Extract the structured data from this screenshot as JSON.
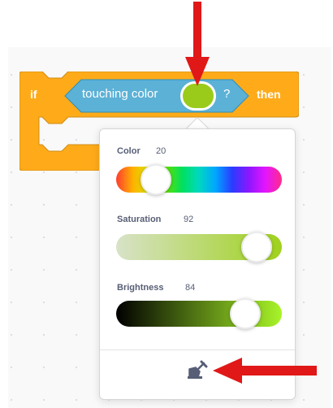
{
  "block": {
    "if_label": "if",
    "sensing_label": "touching color",
    "question_mark": "?",
    "then_label": "then",
    "selected_color": "#9acb1a",
    "control_color": "#ffab19",
    "sensing_color": "#5cb1d6"
  },
  "picker": {
    "color": {
      "label": "Color",
      "value": "20"
    },
    "saturation": {
      "label": "Saturation",
      "value": "92"
    },
    "brightness": {
      "label": "Brightness",
      "value": "84"
    },
    "eyedropper_icon": "eyedropper-icon"
  },
  "annotations": {
    "arrow_color": "#e01818"
  }
}
